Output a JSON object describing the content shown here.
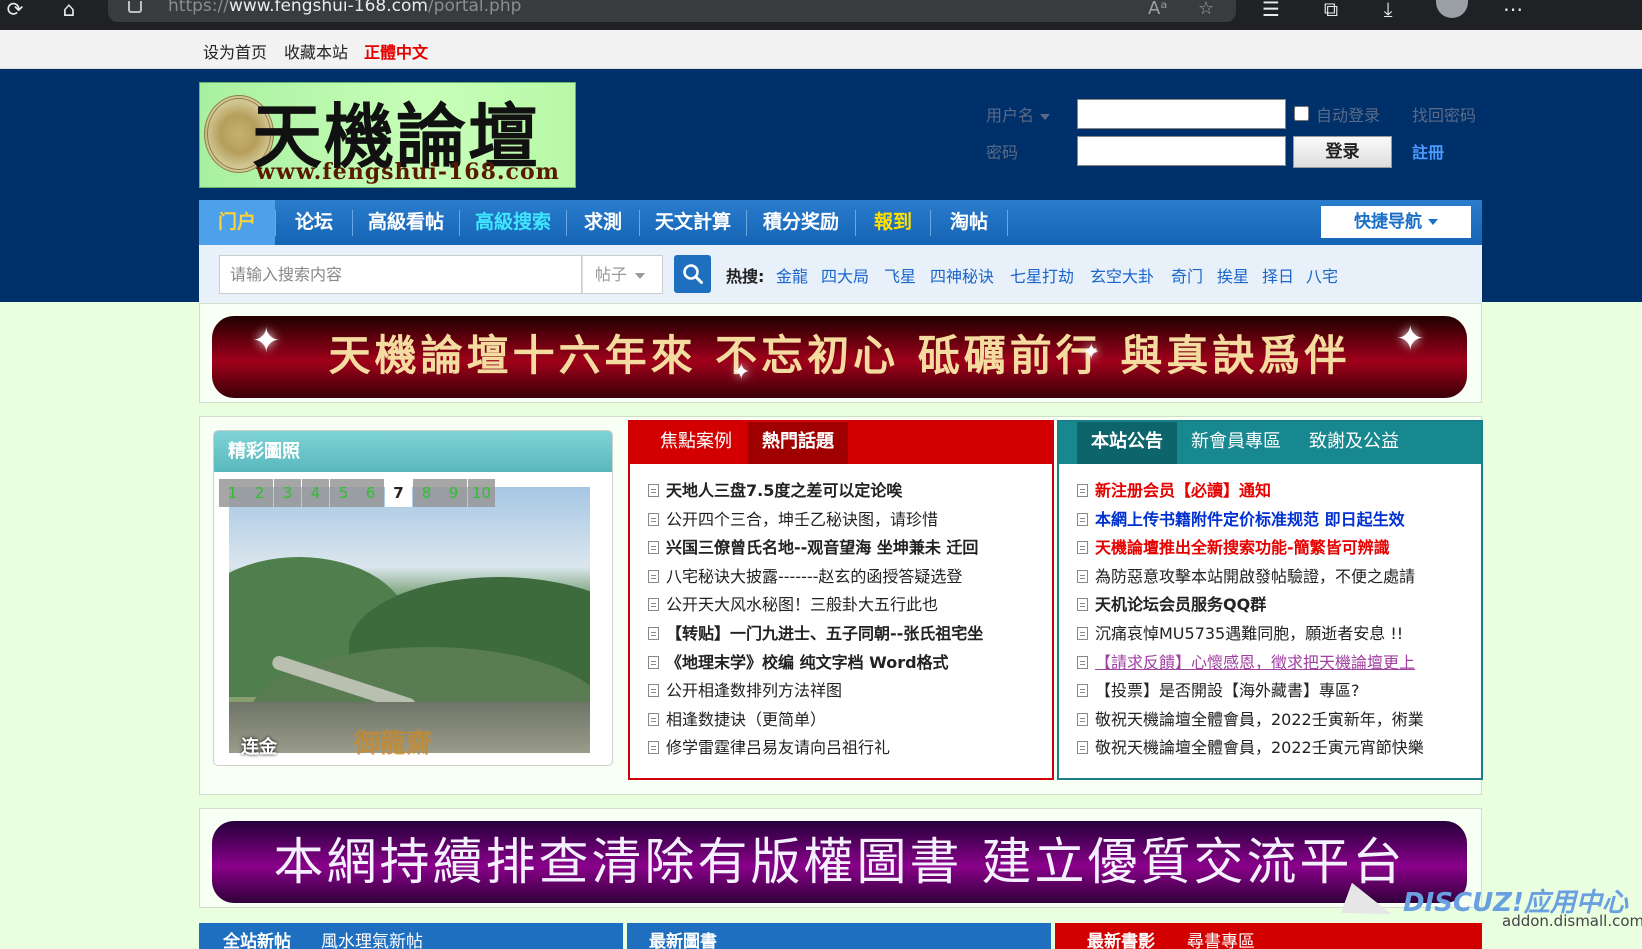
{
  "browser": {
    "url_prefix": "https://",
    "url_host": "www.fengshui-168.com",
    "url_path": "/portal.php",
    "read_aloud_label": "Aᵃ"
  },
  "topbar": {
    "set_home": "设为首页",
    "bookmark": "收藏本站",
    "traditional": "正體中文"
  },
  "logo": {
    "title": "天機論壇",
    "site": "www.fengshui-168.com"
  },
  "login": {
    "username_label": "用户名",
    "password_label": "密码",
    "auto_login": "自动登录",
    "find_password": "找回密码",
    "login_button": "登录",
    "register": "註冊"
  },
  "nav": {
    "items": [
      "门户",
      "论坛",
      "高級看帖",
      "高級搜索",
      "求測",
      "天文計算",
      "積分奖励",
      "報到",
      "淘帖"
    ],
    "quick_nav": "快捷导航"
  },
  "search": {
    "placeholder": "请输入搜索内容",
    "type": "帖子",
    "hot_label": "热搜:",
    "hot_words": [
      "金龍",
      "四大局",
      "飞星",
      "四神秘诀",
      "七星打劫",
      "玄空大卦",
      "奇门",
      "挨星",
      "择日",
      "八宅"
    ]
  },
  "banners": {
    "top": "天機論壇十六年來 不忘初心 砥礪前行 與真訣爲伴",
    "middle": "本網持續排查清除有版權圖書 建立優質交流平台"
  },
  "photos": {
    "title": "精彩圖照",
    "pages": [
      "1",
      "2",
      "3",
      "4",
      "5",
      "6",
      "7",
      "8",
      "9",
      "10"
    ],
    "active_page": "7",
    "caption": "连金",
    "watermark": "御龍齋"
  },
  "focus_panel": {
    "tabs": [
      "焦點案例",
      "熱門話題"
    ],
    "items": [
      "天地人三盘7.5度之差可以定论唉",
      "公开四个三合，坤壬乙秘诀图，请珍惜",
      "兴国三僚曾氏名地--观音望海 坐坤兼未 迁回",
      "八宅秘诀大披露-------赵玄的函授答疑选登",
      "公开天大风水秘图！三般卦大五行此也",
      "【转贴】一门九进士、五子同朝--张氏祖宅坐",
      "《地理末学》校编 纯文字档 Word格式",
      "公开相逢数排列方法祥图",
      "相逢数捷诀（更简单）",
      "修学雷霆律吕易友请向吕祖行礼"
    ]
  },
  "notice_panel": {
    "tabs": [
      "本站公告",
      "新會員專區",
      "致謝及公益"
    ],
    "items": [
      "新注册会员【必讀】通知",
      "本網上传书籍附件定价标准规范 即日起生效",
      "天機論壇推出全新搜索功能-簡繁皆可辨識",
      "為防惡意攻擊本站開啟發帖驗證，不便之處請",
      "天机论坛会员服务QQ群",
      "沉痛哀悼MU5735遇難同胞，願逝者安息 !!",
      "【請求反饋】心懷感恩，徵求把天機論壇更上",
      "【投票】是否開設【海外藏書】專區?",
      "敬祝天機論壇全體會員，2022壬寅新年，術業",
      "敬祝天機論壇全體會員，2022壬寅元宵節快樂"
    ]
  },
  "bottom_tabs": {
    "left": [
      "全站新帖",
      "風水理氣新帖"
    ],
    "middle": [
      "最新圖書"
    ],
    "right": [
      "最新書影",
      "尋書專區"
    ]
  },
  "watermark": {
    "brand": "DISCUZ!应用中心",
    "domain": "addon.dismall.com"
  },
  "colors": {
    "header_bg": "#00306a",
    "nav_bg": "#1564b5",
    "page_bg": "#eaffe0",
    "focus_red": "#d20000",
    "notice_teal": "#178790",
    "hot_link": "#1a66cc"
  }
}
